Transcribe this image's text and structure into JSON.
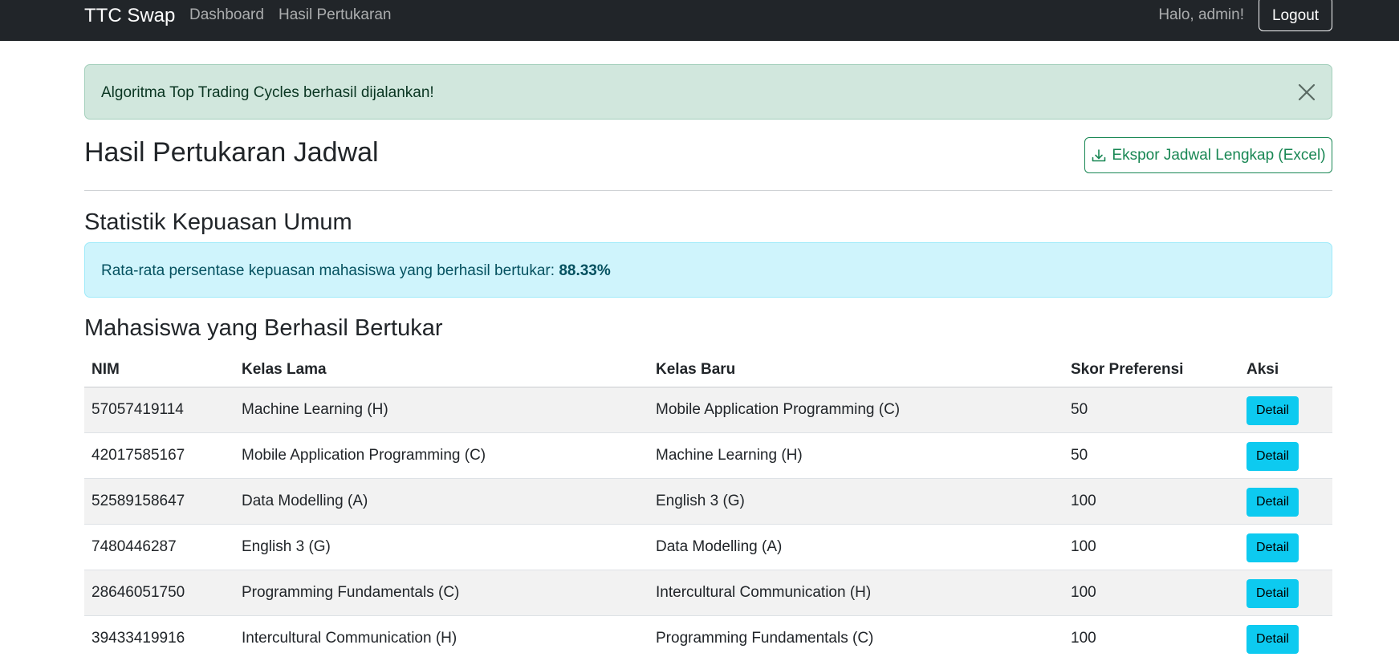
{
  "navbar": {
    "brand": "TTC Swap",
    "links": [
      "Dashboard",
      "Hasil Pertukaran"
    ],
    "greeting": "Halo, admin!",
    "logout_label": "Logout"
  },
  "alert_success": {
    "message": "Algoritma Top Trading Cycles berhasil dijalankan!"
  },
  "page": {
    "title": "Hasil Pertukaran Jadwal",
    "export_label": "Ekspor Jadwal Lengkap (Excel)"
  },
  "stats": {
    "heading": "Statistik Kepuasan Umum",
    "text": "Rata-rata persentase kepuasan mahasiswa yang berhasil bertukar: ",
    "value": "88.33%"
  },
  "table": {
    "heading": "Mahasiswa yang Berhasil Bertukar",
    "columns": [
      "NIM",
      "Kelas Lama",
      "Kelas Baru",
      "Skor Preferensi",
      "Aksi"
    ],
    "action_label": "Detail",
    "rows": [
      {
        "nim": "57057419114",
        "kelas_lama": "Machine Learning (H)",
        "kelas_baru": "Mobile Application Programming (C)",
        "skor": "50"
      },
      {
        "nim": "42017585167",
        "kelas_lama": "Mobile Application Programming (C)",
        "kelas_baru": "Machine Learning (H)",
        "skor": "50"
      },
      {
        "nim": "52589158647",
        "kelas_lama": "Data Modelling (A)",
        "kelas_baru": "English 3 (G)",
        "skor": "100"
      },
      {
        "nim": "7480446287",
        "kelas_lama": "English 3 (G)",
        "kelas_baru": "Data Modelling (A)",
        "skor": "100"
      },
      {
        "nim": "28646051750",
        "kelas_lama": "Programming Fundamentals (C)",
        "kelas_baru": "Intercultural Communication (H)",
        "skor": "100"
      },
      {
        "nim": "39433419916",
        "kelas_lama": "Intercultural Communication (H)",
        "kelas_baru": "Programming Fundamentals (C)",
        "skor": "100"
      }
    ]
  },
  "colors": {
    "navbar_bg": "#212529",
    "success_bg": "#d1e7dd",
    "info_bg": "#cff4fc",
    "export_accent": "#198754",
    "detail_btn": "#0dcaf0"
  },
  "icons": {
    "close": "close-icon",
    "export": "download-icon"
  }
}
